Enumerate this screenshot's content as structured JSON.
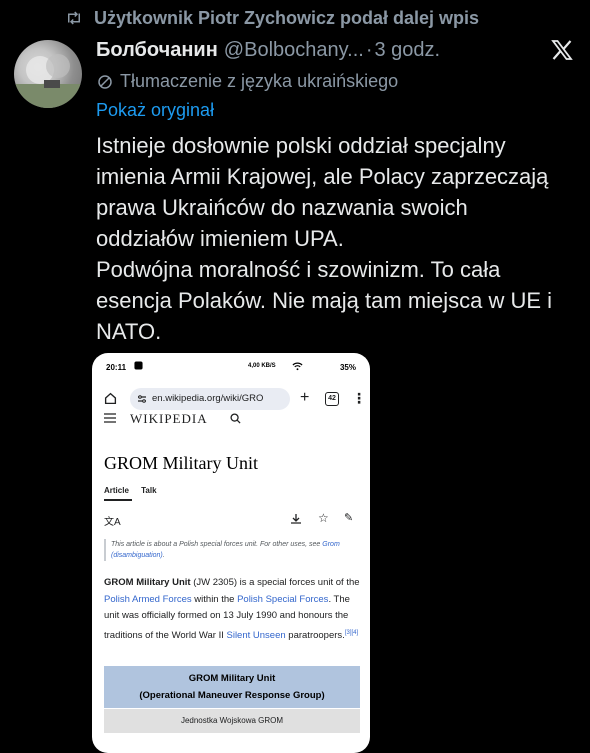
{
  "retweet": {
    "text": "Użytkownik Piotr Zychowicz podał dalej wpis"
  },
  "tweet": {
    "author_name": "Болбочанин",
    "author_handle": "@Bolbochany...",
    "separator": "·",
    "time": "3 godz.",
    "translation_notice": "Tłumaczenie z języka ukraińskiego",
    "show_original": "Pokaż oryginał",
    "text_lines": [
      "Istnieje dosłownie polski oddział specjalny",
      "imienia Armii Krajowej, ale Polacy zaprzeczają",
      "prawa Ukraińców do nazwania swoich",
      "oddziałów imieniem UPA.",
      "Podwójna moralność i szowinizm. To cała",
      "esencja Polaków. Nie mają tam miejsca w UE i",
      "NATO."
    ]
  },
  "embedded_screenshot": {
    "status_time": "20:11",
    "status_network": "4,00 KB/S",
    "status_battery": "35%",
    "url": "en.wikipedia.org/wiki/GRO",
    "tab_count": "42",
    "wiki_logo": "WIKIPEDIA",
    "page_title": "GROM Military Unit",
    "tabs": [
      "Article",
      "Talk"
    ],
    "hatnote_text": "This article is about a Polish special forces unit. For other uses, see",
    "hatnote_link": "Grom (disambiguation)",
    "hatnote_end": ".",
    "body": {
      "bold": "GROM Military Unit",
      "p1": " (JW 2305) is a special forces unit of the ",
      "link1": "Polish Armed Forces",
      "p2": " within the ",
      "link2": "Polish Special Forces",
      "p3": ". The unit was officially formed on 13 July 1990 and honours the traditions of the World War II ",
      "link3": "Silent Unseen",
      "p4": " paratroopers.",
      "refs": "[3][4]"
    },
    "infobox_title": "GROM Military Unit",
    "infobox_subtitle": "(Operational Maneuver Response Group)",
    "infobox_native": "Jednostka Wojskowa GROM"
  },
  "colors": {
    "background": "#000000",
    "link": "#1d9bf0",
    "muted": "#8b98a5",
    "wiki_link": "#3366cc",
    "infobox": "#b0c4de"
  },
  "icons": [
    "retweet-icon",
    "x-logo-icon",
    "translate-icon",
    "home-icon",
    "site-info-icon",
    "plus-icon",
    "more-icon",
    "menu-icon",
    "search-icon",
    "language-icon",
    "download-icon",
    "star-icon",
    "edit-icon"
  ]
}
